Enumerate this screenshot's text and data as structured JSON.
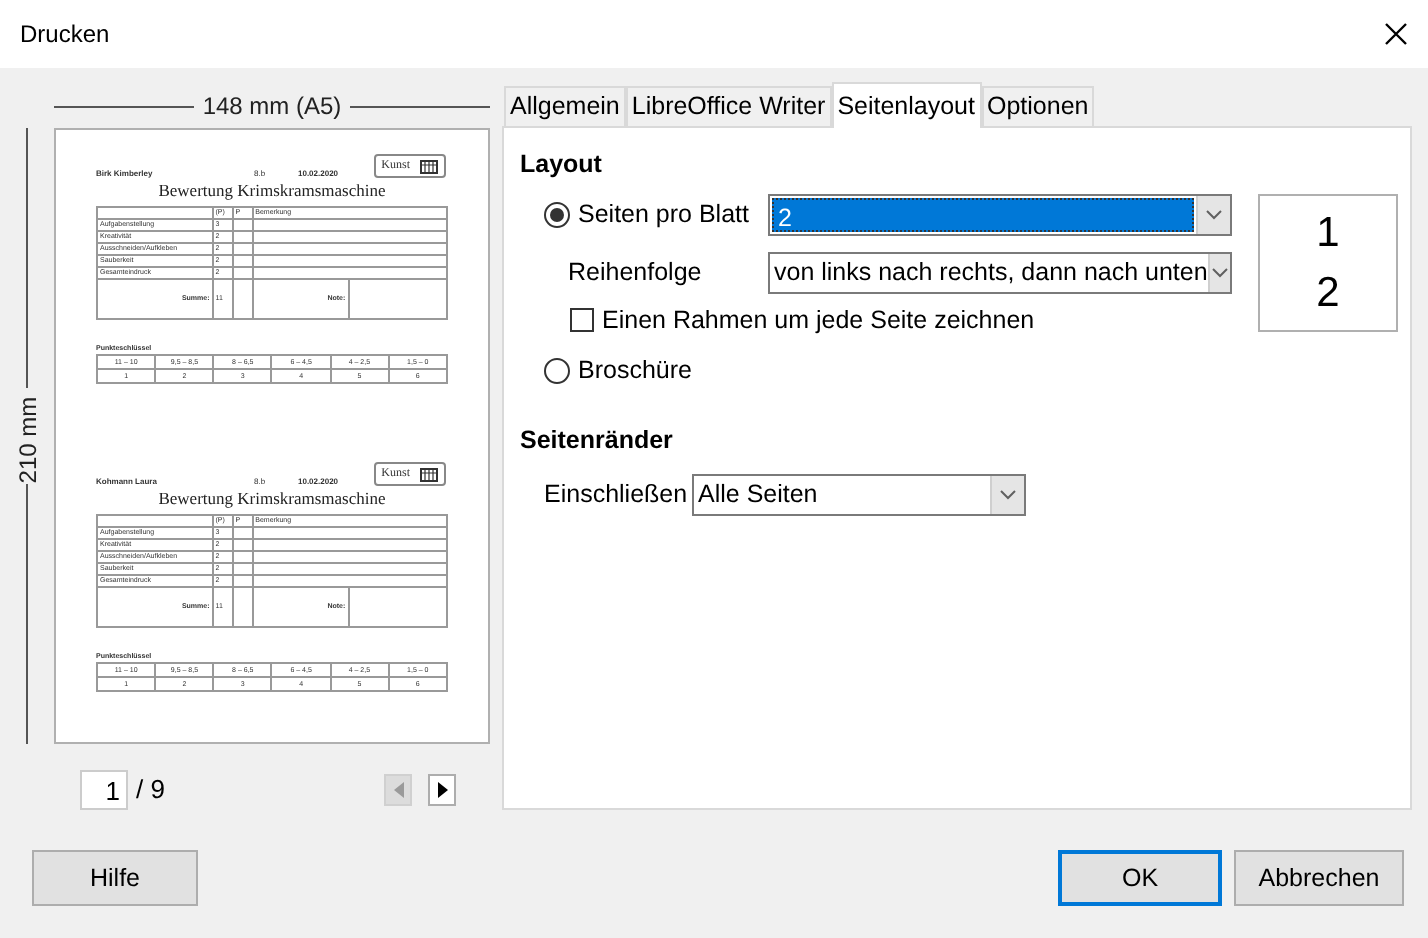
{
  "window": {
    "title": "Drucken"
  },
  "preview": {
    "width_label": "148 mm (A5)",
    "height_label": "210 mm",
    "sheets": [
      {
        "name": "Birk Kimberley",
        "class": "8.b",
        "date": "10.02.2020",
        "subject": "Kunst",
        "title": "Bewertung Krimskramsmaschine",
        "columns": [
          "(P)",
          "P",
          "Bemerkung"
        ],
        "rows": [
          {
            "label": "Aufgabenstellung",
            "max": "3"
          },
          {
            "label": "Kreativität",
            "max": "2"
          },
          {
            "label": "Ausschneiden/Aufkleben",
            "max": "2"
          },
          {
            "label": "Sauberkeit",
            "max": "2"
          },
          {
            "label": "Gesamteindruck",
            "max": "2"
          }
        ],
        "sum_label": "Summe:",
        "sum": "11",
        "grade_label": "Note:",
        "key_title": "Punkteschlüssel",
        "key_ranges": [
          "11 – 10",
          "9,5 – 8,5",
          "8 – 6,5",
          "6 – 4,5",
          "4 – 2,5",
          "1,5 – 0"
        ],
        "key_grades": [
          "1",
          "2",
          "3",
          "4",
          "5",
          "6"
        ]
      },
      {
        "name": "Kohmann Laura",
        "class": "8.b",
        "date": "10.02.2020",
        "subject": "Kunst",
        "title": "Bewertung Krimskramsmaschine",
        "columns": [
          "(P)",
          "P",
          "Bemerkung"
        ],
        "rows": [
          {
            "label": "Aufgabenstellung",
            "max": "3"
          },
          {
            "label": "Kreativität",
            "max": "2"
          },
          {
            "label": "Ausschneiden/Aufkleben",
            "max": "2"
          },
          {
            "label": "Sauberkeit",
            "max": "2"
          },
          {
            "label": "Gesamteindruck",
            "max": "2"
          }
        ],
        "sum_label": "Summe:",
        "sum": "11",
        "grade_label": "Note:",
        "key_title": "Punkteschlüssel",
        "key_ranges": [
          "11 – 10",
          "9,5 – 8,5",
          "8 – 6,5",
          "6 – 4,5",
          "4 – 2,5",
          "1,5 – 0"
        ],
        "key_grades": [
          "1",
          "2",
          "3",
          "4",
          "5",
          "6"
        ]
      }
    ],
    "page_field": "1",
    "page_total": "/ 9",
    "nav": [
      {
        "kind": "prev",
        "disabled": true
      },
      {
        "kind": "next",
        "disabled": false
      }
    ]
  },
  "tabs": [
    {
      "label": "Allgemein",
      "selected": false
    },
    {
      "label": "LibreOffice Writer",
      "selected": false
    },
    {
      "label": "Seitenlayout",
      "selected": true
    },
    {
      "label": "Optionen",
      "selected": false
    }
  ],
  "layout": {
    "heading": "Layout",
    "pages_per_sheet": {
      "label": "Seiten pro Blatt",
      "selected": true,
      "value": "2"
    },
    "order": {
      "label": "Reihenfolge",
      "value": "von links nach rechts, dann nach unten"
    },
    "border": {
      "label": "Einen Rahmen um jede Seite zeichnen",
      "checked": false
    },
    "brochure": {
      "label": "Broschüre",
      "selected": false
    },
    "sample": [
      "1",
      "2"
    ]
  },
  "margins": {
    "heading": "Seitenränder",
    "include": {
      "label": "Einschließen",
      "value": "Alle Seiten"
    }
  },
  "buttons": [
    {
      "label": "Hilfe",
      "default": false
    },
    {
      "label": "OK",
      "default": true
    },
    {
      "label": "Abbrechen",
      "default": false
    }
  ]
}
